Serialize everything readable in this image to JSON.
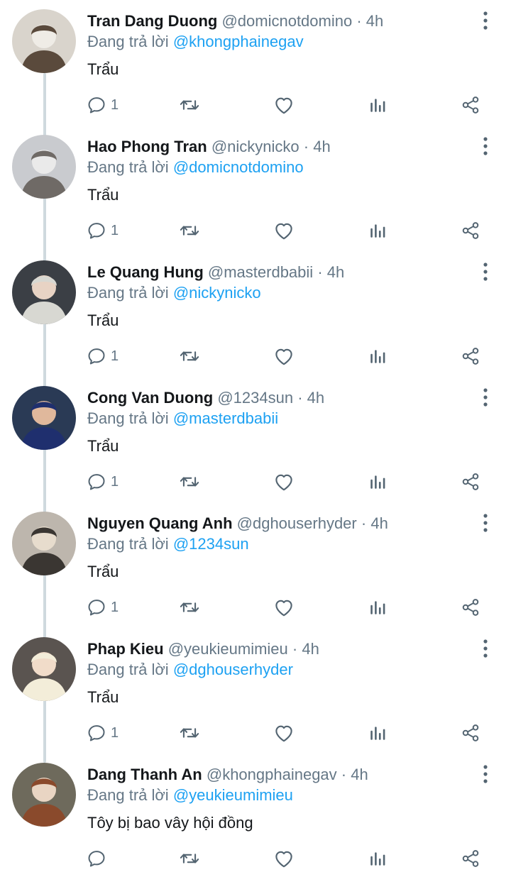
{
  "reply_prefix": "Đang trả lời",
  "separator": "·",
  "tweets": [
    {
      "name": "Tran Dang Duong",
      "handle": "@domicnotdomino",
      "time": "4h",
      "reply_to": "@khongphainegav",
      "text": "Trẩu",
      "reply_count": "1",
      "avatar_icon": "avatar-photo-cat",
      "avatar_colors": {
        "bg": "#d9d4cc",
        "figure": "#efece6",
        "accent": "#5a4a3c"
      }
    },
    {
      "name": "Hao Phong Tran",
      "handle": "@nickynicko",
      "time": "4h",
      "reply_to": "@domicnotdomino",
      "text": "Trẩu",
      "reply_count": "1",
      "avatar_icon": "avatar-photo-person",
      "avatar_colors": {
        "bg": "#c9cbcf",
        "figure": "#eaeaea",
        "accent": "#6f6a66"
      }
    },
    {
      "name": "Le Quang Hung",
      "handle": "@masterdbabii",
      "time": "4h",
      "reply_to": "@nickynicko",
      "text": "Trẩu",
      "reply_count": "1",
      "avatar_icon": "avatar-photo-person",
      "avatar_colors": {
        "bg": "#3b3f45",
        "figure": "#e8d3c4",
        "accent": "#d8d8d2"
      }
    },
    {
      "name": "Cong Van Duong",
      "handle": "@1234sun",
      "time": "4h",
      "reply_to": "@masterdbabii",
      "text": "Trẩu",
      "reply_count": "1",
      "avatar_icon": "avatar-photo-person",
      "avatar_colors": {
        "bg": "#2a3a55",
        "figure": "#e0b89c",
        "accent": "#1f2f6e"
      }
    },
    {
      "name": "Nguyen Quang Anh",
      "handle": "@dghouserhyder",
      "time": "4h",
      "reply_to": "@1234sun",
      "text": "Trẩu",
      "reply_count": "1",
      "avatar_icon": "avatar-photo-person",
      "avatar_colors": {
        "bg": "#bdb6ad",
        "figure": "#e7dccd",
        "accent": "#3a3632"
      }
    },
    {
      "name": "Phap Kieu",
      "handle": "@yeukieumimieu",
      "time": "4h",
      "reply_to": "@dghouserhyder",
      "text": "Trẩu",
      "reply_count": "1",
      "avatar_icon": "avatar-photo-person",
      "avatar_colors": {
        "bg": "#5a5450",
        "figure": "#f1dcc9",
        "accent": "#f3edd9"
      }
    },
    {
      "name": "Dang Thanh An",
      "handle": "@khongphainegav",
      "time": "4h",
      "reply_to": "@yeukieumimieu",
      "text": "Tôy bị bao vây hội đồng",
      "reply_count": "",
      "avatar_icon": "avatar-photo-person",
      "avatar_colors": {
        "bg": "#6e6a5c",
        "figure": "#e9d5c3",
        "accent": "#8a4a2c"
      }
    }
  ],
  "icons": [
    "more-vertical-icon",
    "reply-icon",
    "retweet-icon",
    "like-icon",
    "views-icon",
    "share-icon"
  ],
  "colors": {
    "link": "#1da1f2",
    "muted": "#657786",
    "text": "#14171a",
    "thread_line": "#cfd9de"
  }
}
